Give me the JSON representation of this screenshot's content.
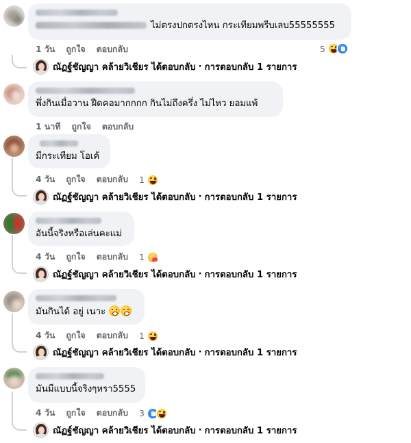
{
  "comments": [
    {
      "text": "ไม่ตรงปกตรงไหน กระเทียมพรีบเลบ55555555",
      "time": "1 วัน",
      "like": "ถูกใจ",
      "reply": "ตอบกลับ",
      "reaction_count": "5",
      "reactions": [
        "haha-icon",
        "like-icon"
      ]
    },
    {
      "text": "พึ่งกินเมื่อวาน ฝืดคอมากกกก กินไม่ถึงครึ่ง ไม่ไหว ยอมแพ้",
      "time": "1 นาที",
      "like": "ถูกใจ",
      "reply": "ตอบกลับ",
      "reaction_count": "",
      "reactions": []
    },
    {
      "text": "มีกระเทียม โอเค้",
      "time": "4 วัน",
      "like": "ถูกใจ",
      "reply": "ตอบกลับ",
      "reaction_count": "1",
      "reactions": [
        "haha-icon"
      ]
    },
    {
      "text": "อันนี้จริงหรือเล่นคะแม่",
      "time": "4 วัน",
      "like": "ถูกใจ",
      "reply": "ตอบกลับ",
      "reaction_count": "1",
      "reactions": [
        "care-icon"
      ]
    },
    {
      "text": "มันกินได้ อยู่ เนาะ",
      "time": "4 วัน",
      "like": "ถูกใจ",
      "reply": "ตอบกลับ",
      "reaction_count": "1",
      "reactions": [
        "haha-icon"
      ]
    },
    {
      "text": "มันมีแบบนี้จริงๆหรา5555",
      "time": "4 วัน",
      "like": "ถูกใจ",
      "reply": "ตอบกลับ",
      "reaction_count": "3",
      "reactions": [
        "like-icon",
        "haha-icon"
      ]
    }
  ],
  "replies": {
    "author": "ณัฏฐ์ชัญญา คล้ายวิเชียร",
    "action": "ได้ตอบกลับ",
    "separator": "·",
    "count": "การตอบกลับ 1 รายการ"
  },
  "colors": {
    "bubble": "#f0f2f5",
    "secondary_text": "#65676b",
    "primary_text": "#050505",
    "like_blue": "#1877f2",
    "haha_yellow": "#f7b125",
    "thread_line": "#ced0d4"
  }
}
